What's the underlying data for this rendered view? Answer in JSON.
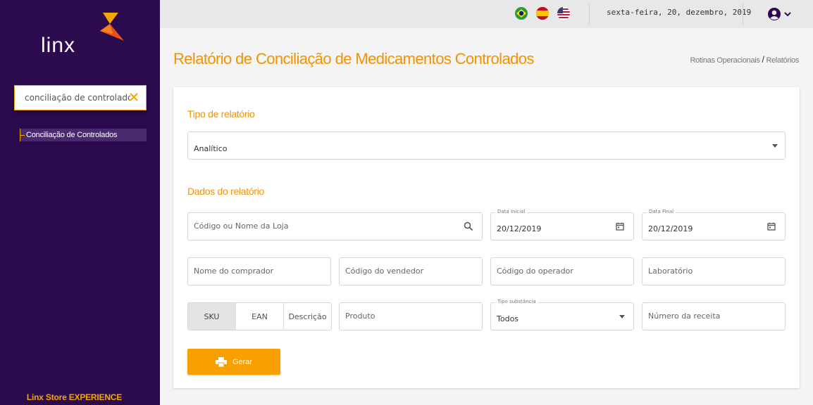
{
  "sidebar": {
    "logo_text": "Linx",
    "search": {
      "value": "conciliação de controlados"
    },
    "menu_items": [
      {
        "label": "Conciliação de Controlados"
      }
    ],
    "footer": "Linx Store EXPERIENCE"
  },
  "topbar": {
    "languages": [
      {
        "icon": "brazil-flag-icon"
      },
      {
        "icon": "spain-flag-icon"
      },
      {
        "icon": "usa-flag-icon"
      }
    ],
    "date": "sexta-feira, 20, dezembro, 2019",
    "user_icon": "user-circle-icon"
  },
  "header": {
    "title": "Relatório de Conciliação de Medicamentos Controlados",
    "breadcrumb": {
      "first": "Rotinas Operacionais",
      "separator": "/",
      "second": "Relatórios"
    }
  },
  "form": {
    "tipo_section": "Tipo de relatório",
    "tipo_value": "Analítico",
    "dados_section": "Dados do relatório",
    "loja_placeholder": "Código ou Nome da Loja",
    "data_inicial": {
      "label": "Data Inicial",
      "value": "20/12/2019"
    },
    "data_final": {
      "label": "Data Final",
      "value": "20/12/2019"
    },
    "comprador_placeholder": "Nome do comprador",
    "vendedor_placeholder": "Código do vendedor",
    "operador_placeholder": "Código do operador",
    "laboratorio_placeholder": "Laboratório",
    "product_toggle": [
      "SKU",
      "EAN",
      "Descrição"
    ],
    "product_toggle_active": "SKU",
    "produto_placeholder": "Produto",
    "tipo_substancia": {
      "label": "Tipo substância",
      "value": "Todos"
    },
    "receita_placeholder": "Número da receita",
    "gerar_label": "Gerar"
  },
  "colors": {
    "accent": "#f39200",
    "sidebar": "#2c0a4e",
    "button": "#f7a000"
  }
}
